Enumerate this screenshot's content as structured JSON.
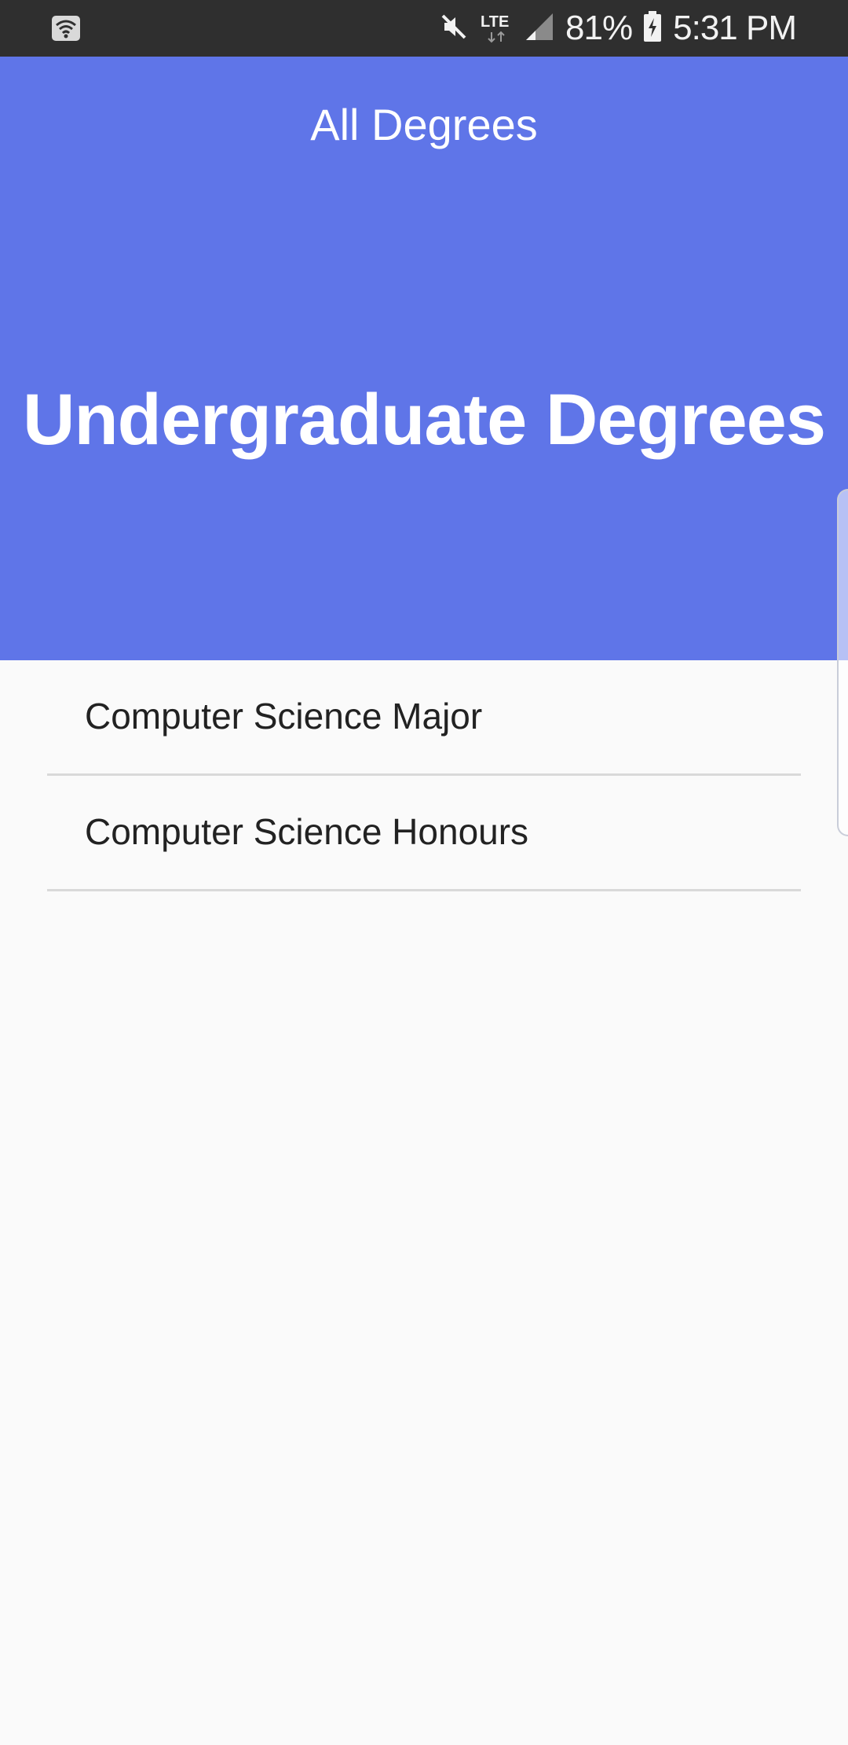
{
  "status_bar": {
    "battery": "81%",
    "time": "5:31 PM",
    "network": "LTE",
    "icons": [
      "wifi-icon",
      "mute-icon",
      "lte-icon",
      "signal-icon",
      "battery-charging-icon"
    ]
  },
  "header": {
    "title": "All Degrees",
    "headline": "Undergraduate Degrees",
    "background_color": "#5f75e8"
  },
  "list": {
    "items": [
      {
        "label": "Computer Science Major"
      },
      {
        "label": "Computer Science Honours"
      }
    ]
  }
}
